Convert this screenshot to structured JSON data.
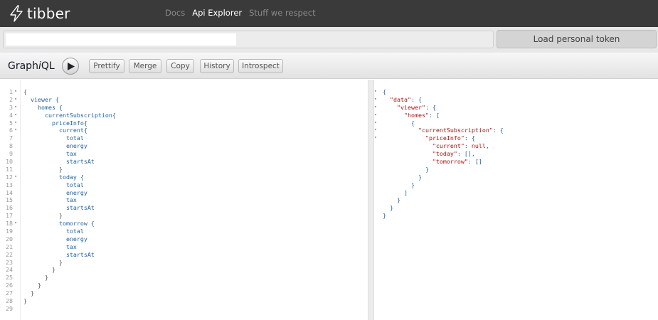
{
  "nav": {
    "logo_text": "tibber",
    "links": [
      {
        "label": "Docs",
        "active": false
      },
      {
        "label": "Api Explorer",
        "active": true
      },
      {
        "label": "Stuff we respect",
        "active": false
      }
    ]
  },
  "token": {
    "input_value": "",
    "button_label": "Load personal token"
  },
  "toolbar": {
    "title_prefix": "Graph",
    "title_italic": "i",
    "title_suffix": "QL",
    "buttons": [
      "Prettify",
      "Merge",
      "Copy",
      "History",
      "Introspect"
    ]
  },
  "query": {
    "line_numbers": [
      "1",
      "2",
      "3",
      "4",
      "5",
      "6",
      "7",
      "8",
      "9",
      "10",
      "11",
      "12",
      "13",
      "14",
      "15",
      "16",
      "17",
      "18",
      "19",
      "20",
      "21",
      "22",
      "23",
      "24",
      "25",
      "26",
      "27",
      "28",
      "29"
    ],
    "fold_markers": [
      "▾",
      "▾",
      "▾",
      "▾",
      "▾",
      "▾",
      "",
      "",
      "",
      "",
      "",
      "▾",
      "",
      "",
      "",
      "",
      "",
      "▾",
      "",
      "",
      "",
      "",
      "",
      "",
      "",
      "",
      "",
      "",
      ""
    ],
    "lines": [
      "{",
      "  viewer {",
      "    homes {",
      "      currentSubscription{",
      "        priceInfo{",
      "          current{",
      "            total",
      "            energy",
      "            tax",
      "            startsAt",
      "          }",
      "          today {",
      "            total",
      "            energy",
      "            tax",
      "            startsAt",
      "          }",
      "          tomorrow {",
      "            total",
      "            energy",
      "            tax",
      "            startsAt",
      "          }",
      "        }",
      "      }",
      "    }",
      "  }",
      "}",
      ""
    ]
  },
  "result": {
    "fold_markers": [
      "▾",
      "▾",
      "▾",
      "▾",
      "▾",
      "▾",
      "▾",
      "",
      "",
      "",
      "",
      "",
      "",
      "",
      "",
      "",
      "",
      "",
      ""
    ],
    "lines": [
      [
        {
          "t": "{",
          "c": "p"
        }
      ],
      [
        {
          "t": "  ",
          "c": "p"
        },
        {
          "t": "\"data\"",
          "c": "k"
        },
        {
          "t": ": {",
          "c": "p"
        }
      ],
      [
        {
          "t": "    ",
          "c": "p"
        },
        {
          "t": "\"viewer\"",
          "c": "k"
        },
        {
          "t": ": {",
          "c": "p"
        }
      ],
      [
        {
          "t": "      ",
          "c": "p"
        },
        {
          "t": "\"homes\"",
          "c": "k"
        },
        {
          "t": ": [",
          "c": "p"
        }
      ],
      [
        {
          "t": "        {",
          "c": "p"
        }
      ],
      [
        {
          "t": "          ",
          "c": "p"
        },
        {
          "t": "\"currentSubscription\"",
          "c": "k"
        },
        {
          "t": ": {",
          "c": "p"
        }
      ],
      [
        {
          "t": "            ",
          "c": "p"
        },
        {
          "t": "\"priceInfo\"",
          "c": "k"
        },
        {
          "t": ": {",
          "c": "p"
        }
      ],
      [
        {
          "t": "              ",
          "c": "p"
        },
        {
          "t": "\"current\"",
          "c": "k"
        },
        {
          "t": ": ",
          "c": "p"
        },
        {
          "t": "null",
          "c": "n"
        },
        {
          "t": ",",
          "c": "p"
        }
      ],
      [
        {
          "t": "              ",
          "c": "p"
        },
        {
          "t": "\"today\"",
          "c": "k"
        },
        {
          "t": ": [],",
          "c": "p"
        }
      ],
      [
        {
          "t": "              ",
          "c": "p"
        },
        {
          "t": "\"tomorrow\"",
          "c": "k"
        },
        {
          "t": ": []",
          "c": "p"
        }
      ],
      [
        {
          "t": "            }",
          "c": "p"
        }
      ],
      [
        {
          "t": "          }",
          "c": "p"
        }
      ],
      [
        {
          "t": "        }",
          "c": "p"
        }
      ],
      [
        {
          "t": "      ]",
          "c": "p"
        }
      ],
      [
        {
          "t": "    }",
          "c": "p"
        }
      ],
      [
        {
          "t": "  }",
          "c": "p"
        }
      ],
      [
        {
          "t": "}",
          "c": "p"
        }
      ]
    ]
  },
  "colors": {
    "nav_bg": "#3a3a3a",
    "field_blue": "#1f61a0",
    "json_key": "#a11",
    "null_red": "#b11a04"
  }
}
